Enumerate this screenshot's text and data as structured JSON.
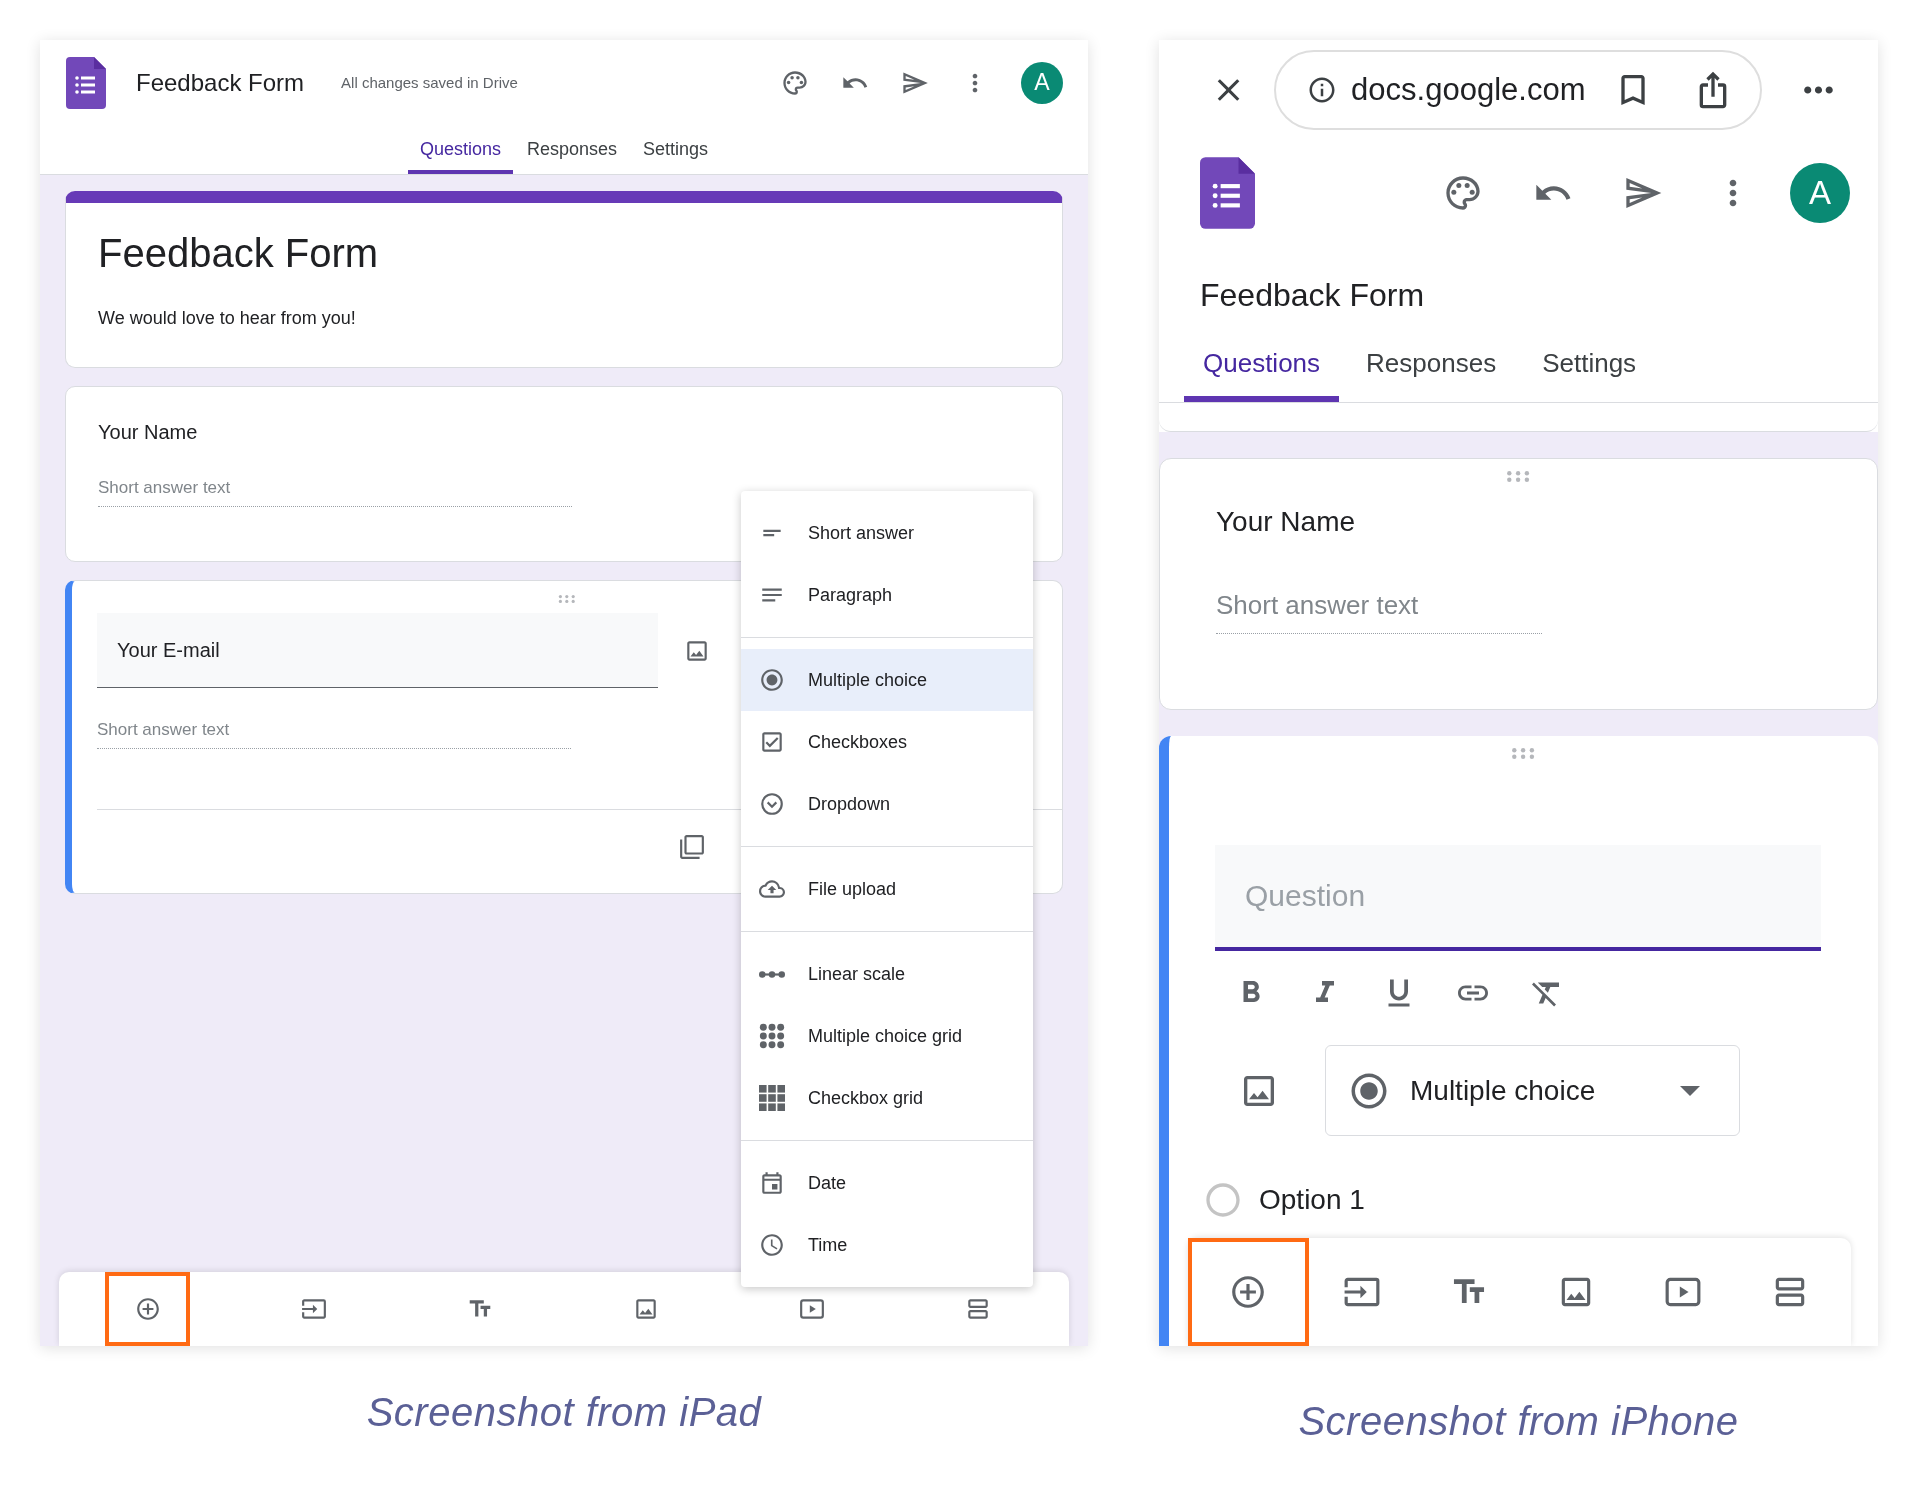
{
  "ipad_screen": {
    "header": {
      "title": "Feedback Form",
      "status": "All changes saved in Drive",
      "avatar": "A"
    },
    "tabs": [
      {
        "label": "Questions",
        "selected": true
      },
      {
        "label": "Responses",
        "selected": false
      },
      {
        "label": "Settings",
        "selected": false
      }
    ],
    "form_header": {
      "title": "Feedback Form",
      "description": "We would love to hear from you!"
    },
    "questions": [
      {
        "title": "Your Name",
        "active": false,
        "answer": {
          "placeholder": "Short answer text"
        }
      },
      {
        "title": "Your E-mail",
        "active": true,
        "answer": {
          "placeholder": "Short answer text"
        }
      }
    ],
    "question_type_menu": {
      "sections": [
        [
          {
            "label": "Short answer",
            "selected": false
          },
          {
            "label": "Paragraph",
            "selected": false
          }
        ],
        [
          {
            "label": "Multiple choice",
            "selected": true
          },
          {
            "label": "Checkboxes",
            "selected": false
          },
          {
            "label": "Dropdown",
            "selected": false
          }
        ],
        [
          {
            "label": "File upload",
            "selected": false
          }
        ],
        [
          {
            "label": "Linear scale",
            "selected": false
          },
          {
            "label": "Multiple choice grid",
            "selected": false
          },
          {
            "label": "Checkbox grid",
            "selected": false
          }
        ],
        [
          {
            "label": "Date",
            "selected": false
          },
          {
            "label": "Time",
            "selected": false
          }
        ]
      ]
    },
    "toolbar": [
      {
        "highlighted": true
      },
      {
        "highlighted": false
      },
      {
        "highlighted": false
      },
      {
        "highlighted": false
      },
      {
        "highlighted": false
      },
      {
        "highlighted": false
      }
    ],
    "caption": "Screenshot from iPad"
  },
  "iphone_screen": {
    "browser": {
      "url": "docs.google.com"
    },
    "header": {
      "avatar": "A"
    },
    "title": "Feedback Form",
    "tabs": [
      {
        "label": "Questions",
        "selected": true
      },
      {
        "label": "Responses",
        "selected": false
      },
      {
        "label": "Settings",
        "selected": false
      }
    ],
    "questions": [
      {
        "title": "Your Name",
        "answer": {
          "placeholder": "Short answer text"
        }
      }
    ],
    "editing_question": {
      "placeholder": "Question",
      "type": "Multiple choice",
      "options": [
        "Option 1"
      ]
    },
    "toolbar": [
      {
        "highlighted": true
      },
      {
        "highlighted": false
      },
      {
        "highlighted": false
      },
      {
        "highlighted": false
      },
      {
        "highlighted": false
      },
      {
        "highlighted": false
      }
    ],
    "caption": "Screenshot from iPhone"
  }
}
